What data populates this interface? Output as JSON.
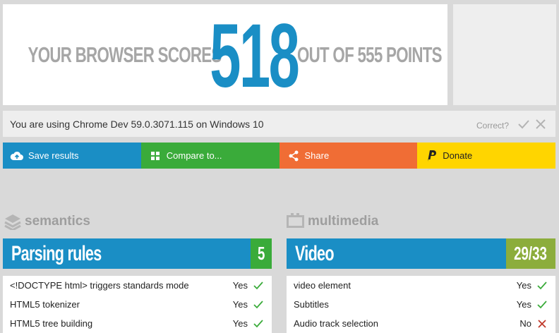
{
  "score": {
    "prefix": "YOUR BROWSER SCORES",
    "value": "518",
    "suffix": "OUT OF 555 POINTS"
  },
  "user_agent": {
    "text": "You are using Chrome Dev 59.0.3071.115 on Windows 10",
    "correct_label": "Correct?"
  },
  "actions": {
    "save": "Save results",
    "compare": "Compare to...",
    "share": "Share",
    "donate": "Donate"
  },
  "sections": {
    "left_title": "semantics",
    "right_title": "multimedia"
  },
  "left_category": {
    "name": "Parsing rules",
    "score": "5",
    "rows": [
      {
        "feature": "<!DOCTYPE html> triggers standards mode",
        "result": "Yes"
      },
      {
        "feature": "HTML5 tokenizer",
        "result": "Yes"
      },
      {
        "feature": "HTML5 tree building",
        "result": "Yes"
      }
    ]
  },
  "right_category": {
    "name": "Video",
    "score": "29/33",
    "rows": [
      {
        "feature": "video element",
        "result": "Yes"
      },
      {
        "feature": "Subtitles",
        "result": "Yes"
      },
      {
        "feature": "Audio track selection",
        "result": "No"
      }
    ]
  },
  "colors": {
    "blue": "#1a8ec5",
    "green": "#3aab3a",
    "orange": "#f06d35",
    "yellow": "#ffd500",
    "olive": "#8cad3c",
    "pass": "#3aab3a",
    "fail": "#c0392b"
  },
  "icons": {
    "save": "cloud-upload-icon",
    "compare": "grid-icon",
    "share": "share-icon",
    "donate": "paypal-icon",
    "semantics": "layers-icon",
    "multimedia": "film-icon",
    "yes": "check-icon",
    "no": "cross-icon"
  }
}
